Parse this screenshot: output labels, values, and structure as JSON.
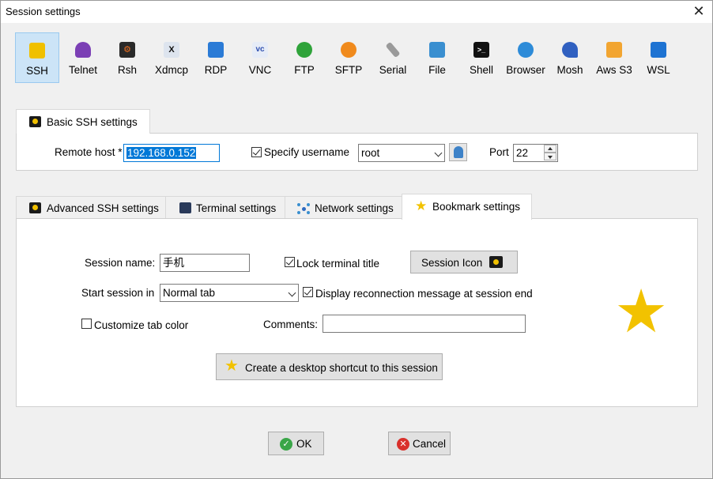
{
  "window": {
    "title": "Session settings"
  },
  "protocols": [
    {
      "label": "SSH",
      "icon": "ssh-key-icon",
      "color": "#1a1a1a"
    },
    {
      "label": "Telnet",
      "icon": "telnet-icon",
      "color": "#7b3fb5"
    },
    {
      "label": "Rsh",
      "icon": "rsh-icon",
      "color": "#c45a1a"
    },
    {
      "label": "Xdmcp",
      "icon": "xdmcp-icon",
      "color": "#444444"
    },
    {
      "label": "RDP",
      "icon": "rdp-icon",
      "color": "#2b7bd6"
    },
    {
      "label": "VNC",
      "icon": "vnc-icon",
      "color": "#4a6fc2"
    },
    {
      "label": "FTP",
      "icon": "ftp-icon",
      "color": "#2fa33a"
    },
    {
      "label": "SFTP",
      "icon": "sftp-icon",
      "color": "#f08a1c"
    },
    {
      "label": "Serial",
      "icon": "serial-icon",
      "color": "#7a7a7a"
    },
    {
      "label": "File",
      "icon": "file-icon",
      "color": "#3a8fd0"
    },
    {
      "label": "Shell",
      "icon": "shell-icon",
      "color": "#111111"
    },
    {
      "label": "Browser",
      "icon": "browser-icon",
      "color": "#2d8bd8"
    },
    {
      "label": "Mosh",
      "icon": "mosh-icon",
      "color": "#3060c0"
    },
    {
      "label": "Aws S3",
      "icon": "aws-s3-icon",
      "color": "#f2a531"
    },
    {
      "label": "WSL",
      "icon": "wsl-icon",
      "color": "#1e73d2"
    }
  ],
  "basic": {
    "tab_label": "Basic SSH settings",
    "remote_host_label": "Remote host *",
    "remote_host_value": "192.168.0.152",
    "specify_username_label": "Specify username",
    "username_value": "root",
    "port_label": "Port",
    "port_value": "22"
  },
  "tabs": [
    {
      "label": "Advanced SSH settings",
      "icon": "key-icon"
    },
    {
      "label": "Terminal settings",
      "icon": "terminal-icon"
    },
    {
      "label": "Network settings",
      "icon": "network-icon"
    },
    {
      "label": "Bookmark settings",
      "icon": "star-icon"
    }
  ],
  "bookmark": {
    "session_name_label": "Session name:",
    "session_name_value": "手机",
    "lock_title_label": "Lock terminal title",
    "session_icon_label": "Session Icon",
    "start_session_label": "Start session in",
    "start_session_value": "Normal tab",
    "reconnect_label": "Display reconnection message at session end",
    "customize_color_label": "Customize tab color",
    "comments_label": "Comments:",
    "comments_value": "",
    "shortcut_label": "Create a desktop shortcut to this session"
  },
  "footer": {
    "ok_label": "OK",
    "cancel_label": "Cancel"
  },
  "colors": {
    "selected_bg": "#cce4f7",
    "star": "#f2c200",
    "ok_green": "#3aa648",
    "cancel_red": "#d9302b"
  }
}
